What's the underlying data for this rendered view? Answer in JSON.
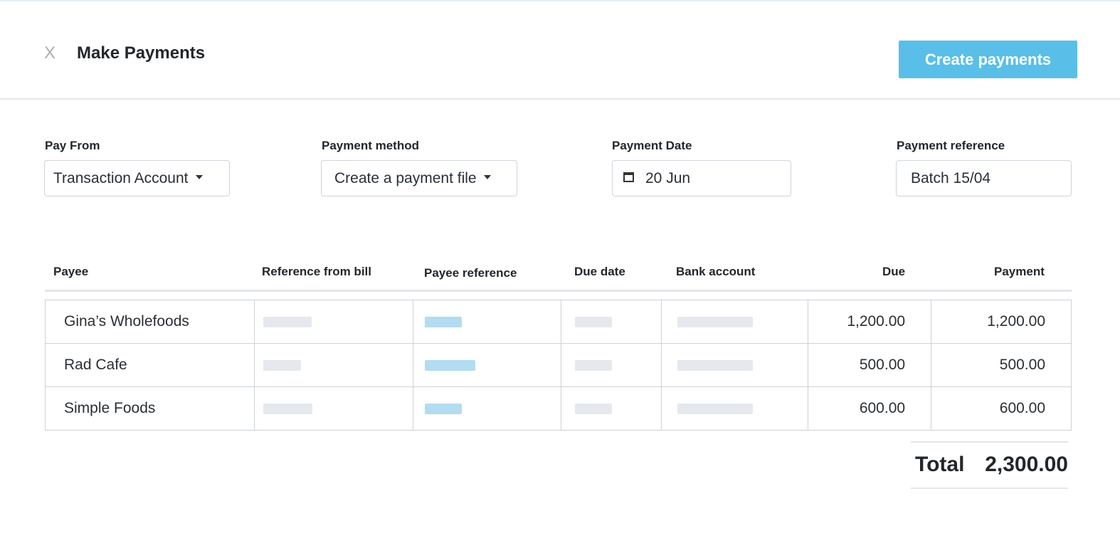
{
  "header": {
    "close_label": "X",
    "title": "Make Payments",
    "create_label": "Create payments"
  },
  "fields": {
    "pay_from": {
      "label": "Pay From",
      "value": "Transaction Account"
    },
    "payment_method": {
      "label": "Payment method",
      "value": "Create a payment file"
    },
    "payment_date": {
      "label": "Payment Date",
      "value": "20 Jun"
    },
    "payment_reference": {
      "label": "Payment reference",
      "value": "Batch 15/04"
    }
  },
  "table": {
    "columns": [
      "Payee",
      "Reference from bill",
      "Payee reference",
      "Due date",
      "Bank account",
      "Due",
      "Payment"
    ],
    "rows": [
      {
        "payee": "Gina’s Wholefoods",
        "due": "1,200.00",
        "payment": "1,200.00"
      },
      {
        "payee": "Rad Cafe",
        "due": "500.00",
        "payment": "500.00"
      },
      {
        "payee": "Simple Foods",
        "due": "600.00",
        "payment": "600.00"
      }
    ]
  },
  "total": {
    "label": "Total",
    "value": "2,300.00"
  },
  "colors": {
    "accent": "#59bfe8",
    "placeholder": "#e5e8ec",
    "placeholder_link": "#b2dcef"
  },
  "icons": {
    "close": "close-icon",
    "dropdown": "caret-down-icon",
    "calendar": "calendar-icon"
  }
}
